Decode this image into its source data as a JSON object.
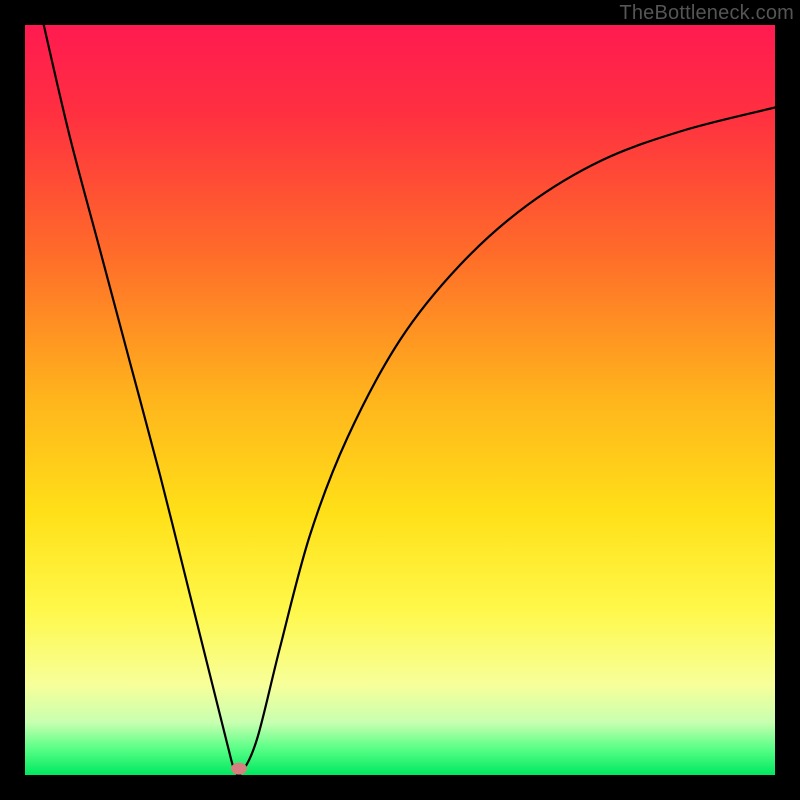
{
  "watermark": "TheBottleneck.com",
  "chart_data": {
    "type": "line",
    "title": "",
    "xlabel": "",
    "ylabel": "",
    "xlim": [
      0,
      100
    ],
    "ylim": [
      0,
      100
    ],
    "gradient_stops": [
      {
        "pos": 0.0,
        "color": "#ff1a50"
      },
      {
        "pos": 0.12,
        "color": "#ff3040"
      },
      {
        "pos": 0.3,
        "color": "#ff6a2a"
      },
      {
        "pos": 0.5,
        "color": "#ffb51c"
      },
      {
        "pos": 0.65,
        "color": "#ffe018"
      },
      {
        "pos": 0.78,
        "color": "#fff84a"
      },
      {
        "pos": 0.88,
        "color": "#f7ff9a"
      },
      {
        "pos": 0.93,
        "color": "#c8ffb0"
      },
      {
        "pos": 0.965,
        "color": "#58ff86"
      },
      {
        "pos": 1.0,
        "color": "#00e860"
      }
    ],
    "series": [
      {
        "name": "bottleneck-curve",
        "points": [
          {
            "x": 2.5,
            "y": 100
          },
          {
            "x": 6,
            "y": 85
          },
          {
            "x": 10,
            "y": 70
          },
          {
            "x": 14,
            "y": 55
          },
          {
            "x": 18,
            "y": 40
          },
          {
            "x": 22,
            "y": 24
          },
          {
            "x": 25,
            "y": 12
          },
          {
            "x": 27,
            "y": 4
          },
          {
            "x": 28,
            "y": 0.5
          },
          {
            "x": 29,
            "y": 0.5
          },
          {
            "x": 31,
            "y": 5
          },
          {
            "x": 34,
            "y": 17
          },
          {
            "x": 38,
            "y": 32
          },
          {
            "x": 43,
            "y": 45
          },
          {
            "x": 50,
            "y": 58
          },
          {
            "x": 58,
            "y": 68
          },
          {
            "x": 67,
            "y": 76
          },
          {
            "x": 77,
            "y": 82
          },
          {
            "x": 88,
            "y": 86
          },
          {
            "x": 100,
            "y": 89
          }
        ]
      }
    ],
    "marker": {
      "x": 28.5,
      "y": 0.5,
      "color": "#d88080"
    }
  }
}
